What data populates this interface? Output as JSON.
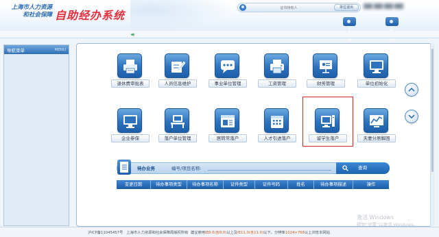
{
  "header": {
    "logo_line1": "上海市人力资源",
    "logo_line2": "和社会保障",
    "system_title": "自助经办系统",
    "user_placeholder": "证书持有人",
    "user_button": "单位退出",
    "tabs": [
      {
        "label": "人事人才"
      },
      {
        "label": "经办大厅"
      }
    ]
  },
  "sidebar": {
    "title": "导航菜单",
    "title_en": "MENU"
  },
  "tiles": [
    {
      "label": "退休费审批表",
      "icon": "printer-form-icon"
    },
    {
      "label": "人员信息维护",
      "icon": "edit-document-icon"
    },
    {
      "label": "事业单位管理",
      "icon": "chat-bubble-icon"
    },
    {
      "label": "工资管理",
      "icon": "printer-icon"
    },
    {
      "label": "财务管理",
      "icon": "presentation-icon"
    },
    {
      "label": "单位初始化",
      "icon": "monitor-icon"
    },
    {
      "label": "企业参保",
      "icon": "monitor-icon"
    },
    {
      "label": "落户单位管理",
      "icon": "desk-icon"
    },
    {
      "label": "居转常落户",
      "icon": "window-icon"
    },
    {
      "label": "人才引进落户",
      "icon": "calendar-icon"
    },
    {
      "label": "留学生落户",
      "icon": "computer-icon"
    },
    {
      "label": "夫妻分居解困",
      "icon": "chart-icon"
    }
  ],
  "todo": {
    "title": "待办业务",
    "field_label": "编号/项目名称:",
    "input_value": "",
    "query_button": "查询",
    "columns": [
      "变更日期",
      "待办事项类型",
      "待办事项名称",
      "证件类型",
      "证件号码",
      "姓名",
      "待办事项描述",
      "操作"
    ]
  },
  "footer": {
    "icp": "沪ICP备11045457号",
    "copyright": "上海市人力资源和社会保障局版权所有",
    "browser_note_prefix": "建议使用",
    "browser_ie": "IE8.0(含8.0)",
    "browser_mid1": "以上及",
    "browser_ie11": "IE11.0(含11.0)",
    "browser_mid2": "以下，分辨率",
    "resolution": "1024×768",
    "browser_suffix": "以上浏览本网站"
  },
  "watermark": {
    "line1": "激活 Windows",
    "line2": "转到\"设置\"以激活 Windows。"
  },
  "colors": {
    "primary_blue": "#2d72bd",
    "title_red": "#e2303c",
    "highlight_red": "#e0261f",
    "footer_highlight": "#d45c1e"
  }
}
